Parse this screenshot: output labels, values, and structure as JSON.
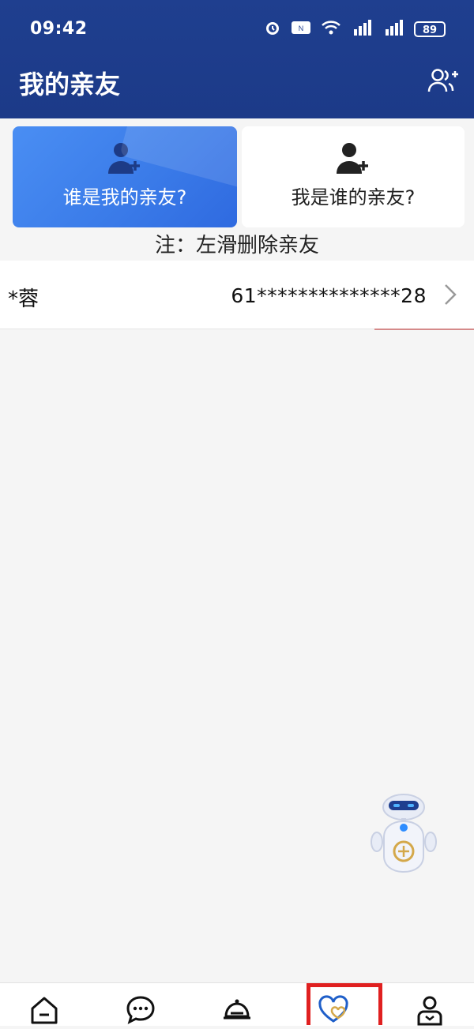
{
  "status_bar": {
    "time": "09:42",
    "battery": "89"
  },
  "header": {
    "title": "我的亲友",
    "add_icon": "add-friends-icon"
  },
  "cards": [
    {
      "label": "谁是我的亲友?",
      "icon": "add-person-icon"
    },
    {
      "label": "我是谁的亲友?",
      "icon": "add-person-icon"
    }
  ],
  "note": "注：左滑删除亲友",
  "friends": [
    {
      "name": "*蓉",
      "id_masked": "61**************28"
    }
  ],
  "bottom_nav": [
    {
      "icon": "home-icon"
    },
    {
      "icon": "message-icon"
    },
    {
      "icon": "service-bell-icon"
    },
    {
      "icon": "heart-icon",
      "selected": true
    },
    {
      "icon": "profile-icon"
    }
  ],
  "colors": {
    "header": "#1f3f8f",
    "card_active": "#3b7ce9",
    "highlight": "#e02020"
  }
}
